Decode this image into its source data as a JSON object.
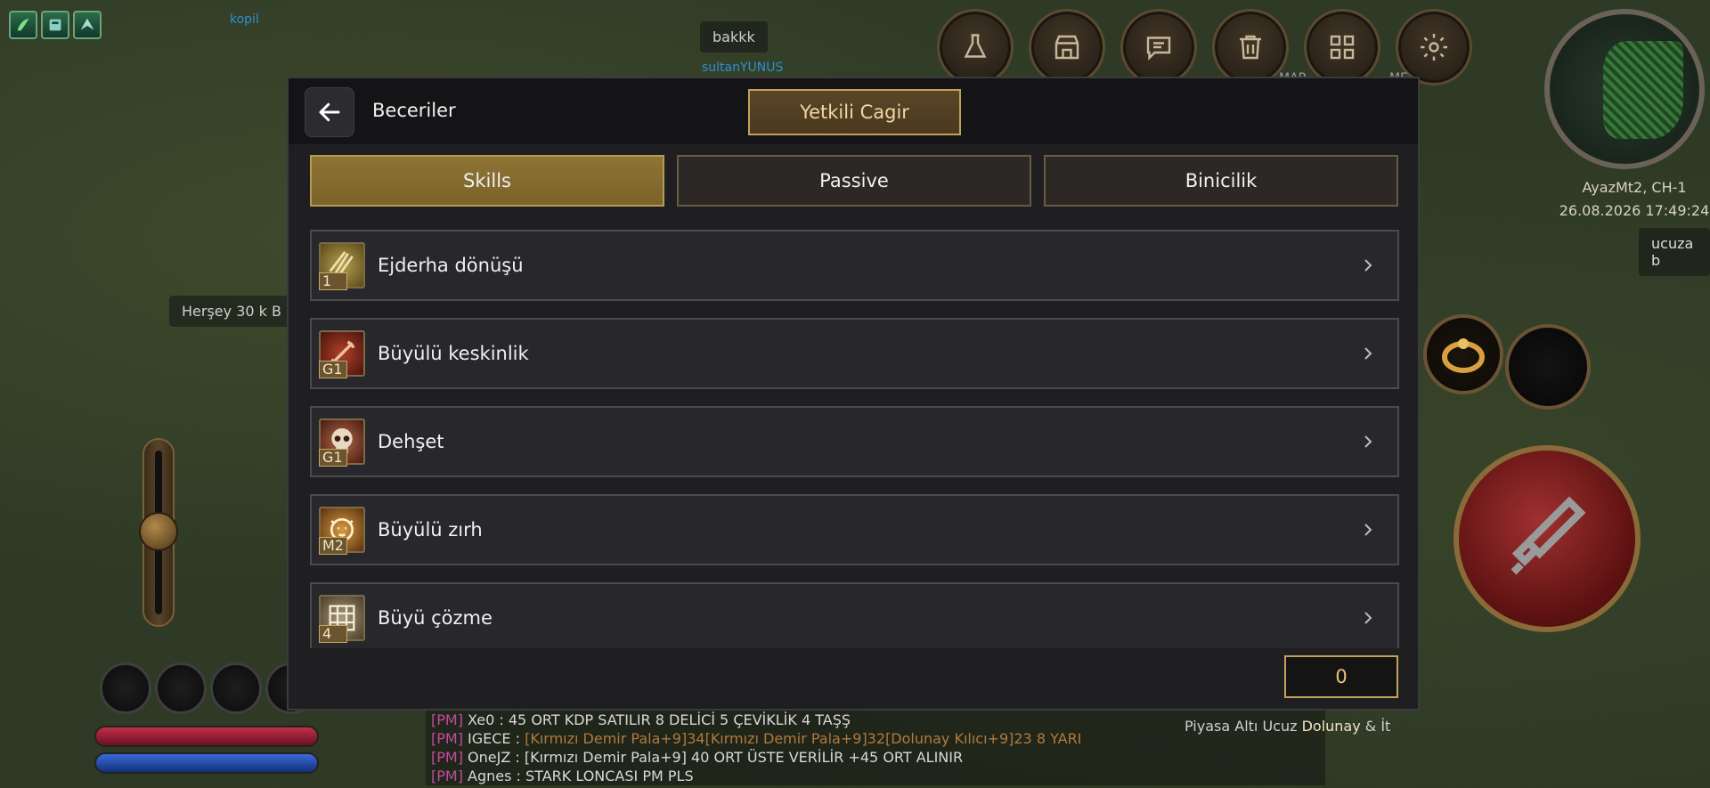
{
  "background": {
    "floating_names": {
      "kopil": "kopil",
      "sultan": "sultanYUNUS",
      "hersey": "Herşey 30 k B",
      "ucuza": "ucuza b",
      "bakkk": "bakkk",
      "map_left": "MAP",
      "map_right": "ME"
    },
    "map_info": {
      "server": "AyazMt2, CH-1",
      "datetime": "26.08.2026 17:49:24"
    },
    "hud_icons": [
      "potion-icon",
      "shop-icon",
      "chat-icon",
      "trash-icon",
      "grid-icon",
      "settings-icon"
    ],
    "chat": [
      {
        "tag": "[PM]",
        "sender": "Xe0 :",
        "text": " 45 ORT KDP SATILIR 8 DELİCİ 5 ÇEVİKLİK 4 TAŞŞ"
      },
      {
        "tag": "[PM]",
        "sender": "IGECE :",
        "text": " [Kırmızı Demir Pala+9]34[Kırmızı Demir Pala+9]32[Dolunay Kılıcı+9]23 8 YARI"
      },
      {
        "tag": "[PM]",
        "sender": "OneJZ :",
        "text": " [Kırmızı Demir Pala+9] 40 ORT ÜSTE VERİLİR +45 ORT ALINIR"
      },
      {
        "tag": "[PM]",
        "sender": "Agnes :",
        "text": " STARK LONCASI PM PLS"
      }
    ],
    "side_chat": {
      "prefix": "Piyasa Altı Ucuz ",
      "highlight": "Dolunay",
      "suffix": "  & İt"
    }
  },
  "dialog": {
    "title": "Beceriler",
    "gm_button": "Yetkili Cagir",
    "tabs": [
      {
        "label": "Skills",
        "active": true
      },
      {
        "label": "Passive",
        "active": false
      },
      {
        "label": "Binicilik",
        "active": false
      }
    ],
    "skills": [
      {
        "name": "Ejderha dönüşü",
        "level": "1",
        "icon": "dragon-claw-icon",
        "color": "#8a7a3a"
      },
      {
        "name": "Büyülü keskinlik",
        "level": "G1",
        "icon": "enchanted-blade-icon",
        "color": "#7a2a1a"
      },
      {
        "name": "Dehşet",
        "level": "G1",
        "icon": "skull-icon",
        "color": "#7a3a2a"
      },
      {
        "name": "Büyülü zırh",
        "level": "M2",
        "icon": "lion-armor-icon",
        "color": "#8a5a1a"
      },
      {
        "name": "Büyü çözme",
        "level": "4",
        "icon": "rune-grid-icon",
        "color": "#6a5a3a"
      }
    ],
    "skill_points": "0"
  },
  "colors": {
    "accent_gold": "#c2a15c",
    "active_tab": "#8e7434",
    "panel_bg": "#1f1e20"
  }
}
